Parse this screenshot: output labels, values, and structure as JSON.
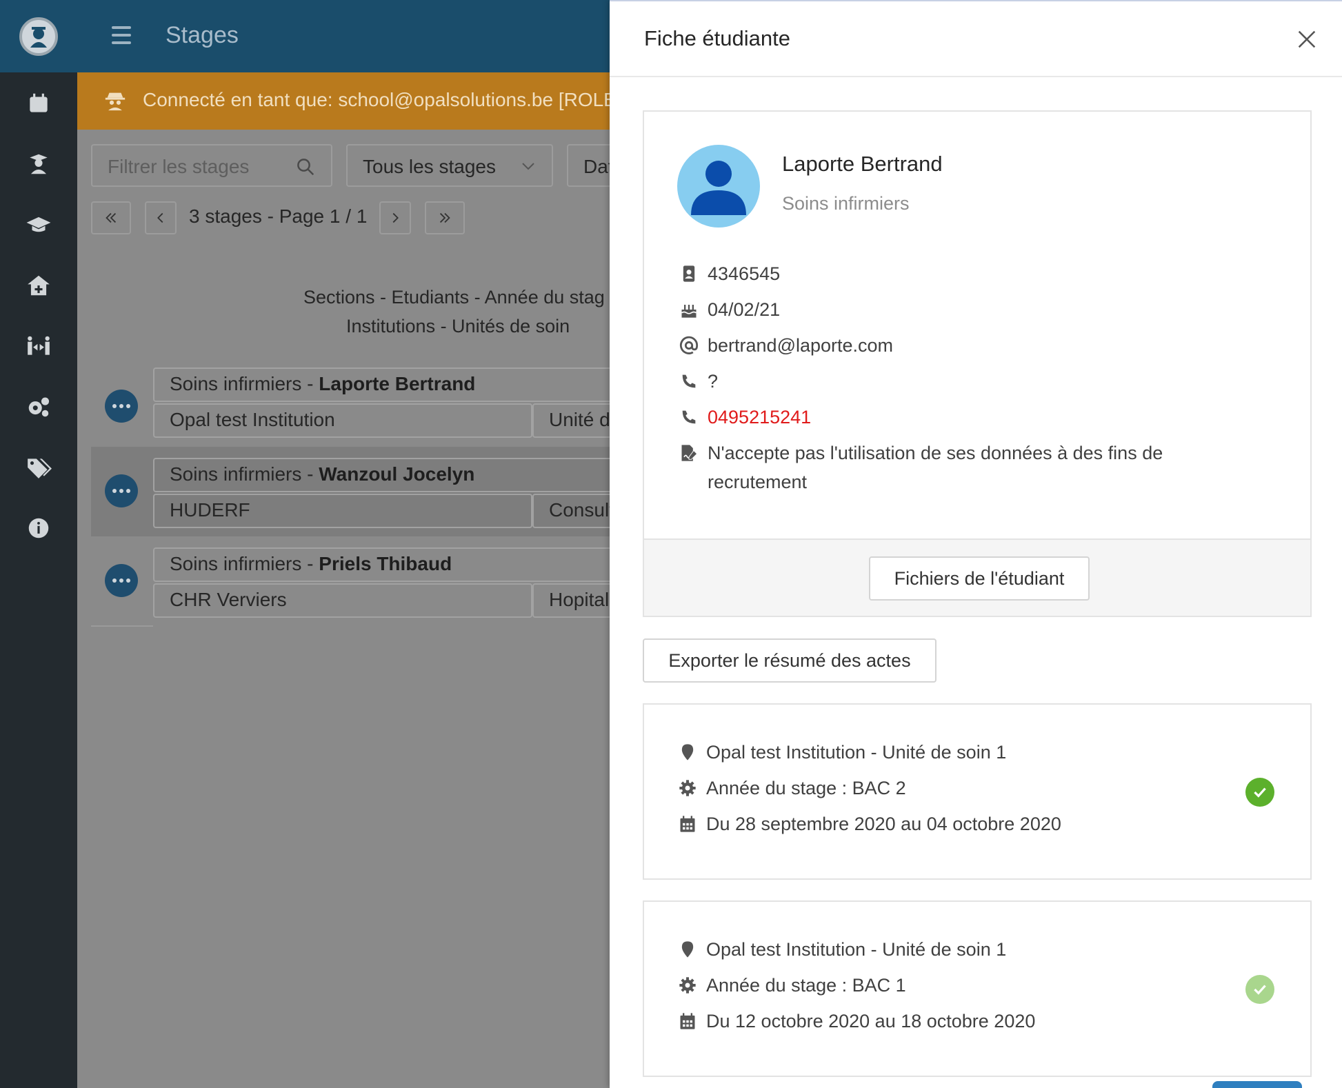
{
  "app": {
    "page_title": "Stages",
    "banner_text": "Connecté en tant que: school@opalsolutions.be [ROLE_"
  },
  "sidebar": {
    "items": [
      {
        "name": "calendar-icon"
      },
      {
        "name": "student-icon"
      },
      {
        "name": "graduation-cap-icon"
      },
      {
        "name": "hospital-icon"
      },
      {
        "name": "people-arrows-icon"
      },
      {
        "name": "settings-icon"
      },
      {
        "name": "tags-icon"
      },
      {
        "name": "info-icon"
      }
    ]
  },
  "filters": {
    "search_placeholder": "Filtrer les stages",
    "stage_select": "Tous les stages",
    "date_select": "Dat"
  },
  "pagination": {
    "text": "3 stages - Page 1 / 1"
  },
  "legend": {
    "line1": "Sections - Etudiants - Année du stag",
    "line2": "Institutions - Unités de soin"
  },
  "stages": [
    {
      "section": "Soins infirmiers - ",
      "student": "Laporte Bertrand",
      "institution": "Opal test Institution",
      "unit": "Unité d"
    },
    {
      "section": "Soins infirmiers - ",
      "student": "Wanzoul Jocelyn",
      "institution": "HUDERF",
      "unit": "Consult"
    },
    {
      "section": "Soins infirmiers - ",
      "student": "Priels Thibaud",
      "institution": "CHR Verviers",
      "unit": "Hopital"
    }
  ],
  "drawer": {
    "title": "Fiche étudiante",
    "student": {
      "name": "Laporte Bertrand",
      "section": "Soins infirmiers",
      "matricule": "4346545",
      "birthdate": "04/02/21",
      "email": "bertrand@laporte.com",
      "phone": "?",
      "mobile": "0495215241",
      "consent_line1": "N'accepte pas l'utilisation de ses données à des fins de",
      "consent_line2": "recrutement"
    },
    "files_button": "Fichiers de l'étudiant",
    "export_button": "Exporter le résumé des actes",
    "internships": [
      {
        "place": "Opal test Institution - Unité de soin 1",
        "year": "Année du stage : BAC 2",
        "period": "Du 28 septembre 2020 au 04 octobre 2020",
        "status_color": "#5cb02c"
      },
      {
        "place": "Opal test Institution - Unité de soin 1",
        "year": "Année du stage : BAC 1",
        "period": "Du 12 octobre 2020 au 18 octobre 2020",
        "status_color": "#a9d68d"
      }
    ]
  },
  "colors": {
    "sidebar": "#232a2f",
    "header": "#1a4d6b",
    "banner": "#b97a1d",
    "accent_red": "#e01b1b",
    "check_green": "#5cb02c"
  }
}
